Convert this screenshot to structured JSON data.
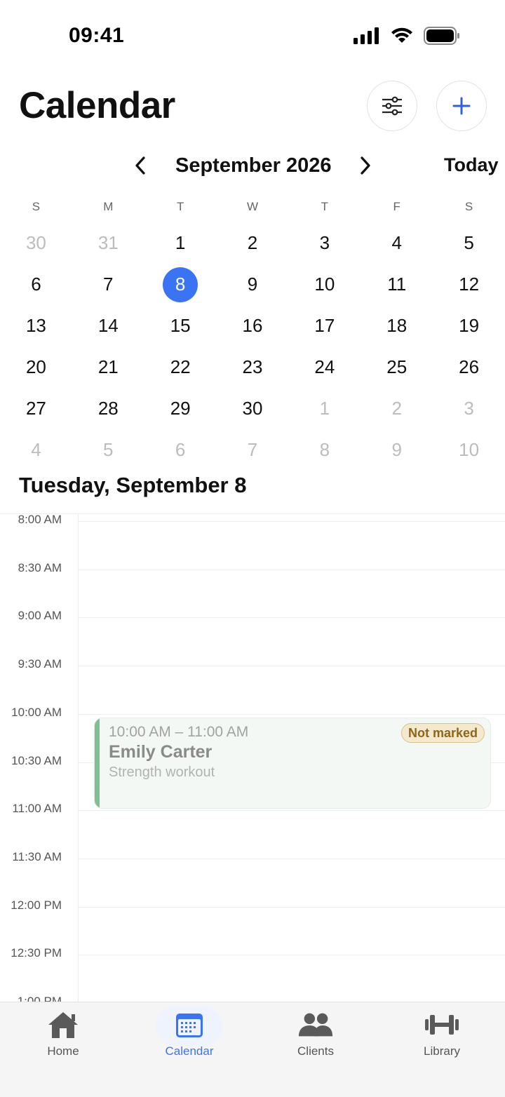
{
  "status_bar": {
    "time": "09:41"
  },
  "header": {
    "title": "Calendar"
  },
  "month_nav": {
    "label": "September 2026",
    "today_label": "Today"
  },
  "weekdays": [
    "S",
    "M",
    "T",
    "W",
    "T",
    "F",
    "S"
  ],
  "weeks": [
    [
      "30",
      "31",
      "1",
      "2",
      "3",
      "4",
      "5"
    ],
    [
      "6",
      "7",
      "8",
      "9",
      "10",
      "11",
      "12"
    ],
    [
      "13",
      "14",
      "15",
      "16",
      "17",
      "18",
      "19"
    ],
    [
      "20",
      "21",
      "22",
      "23",
      "24",
      "25",
      "26"
    ],
    [
      "27",
      "28",
      "29",
      "30",
      "1",
      "2",
      "3"
    ],
    [
      "4",
      "5",
      "6",
      "7",
      "8",
      "9",
      "10"
    ]
  ],
  "selected_day": "8",
  "day_heading": "Tuesday, September 8",
  "time_slots": [
    "8:00 AM",
    "8:30 AM",
    "9:00 AM",
    "9:30 AM",
    "10:00 AM",
    "10:30 AM",
    "11:00 AM",
    "11:30 AM",
    "12:00 PM",
    "12:30 PM",
    "1:00 PM"
  ],
  "event": {
    "time_range": "10:00 AM – 11:00 AM",
    "client_name": "Emily Carter",
    "session_type": "Strength workout",
    "status_badge": "Not marked"
  },
  "tabs": [
    {
      "label": "Home",
      "icon": "home-icon"
    },
    {
      "label": "Calendar",
      "icon": "calendar-icon",
      "active": true
    },
    {
      "label": "Clients",
      "icon": "clients-icon"
    },
    {
      "label": "Library",
      "icon": "dumbbell-icon"
    }
  ],
  "colors": {
    "accent": "#3b74f2",
    "event_accent": "#7fbf94",
    "badge_bg": "#f4e8cd",
    "badge_text": "#8d6619"
  }
}
